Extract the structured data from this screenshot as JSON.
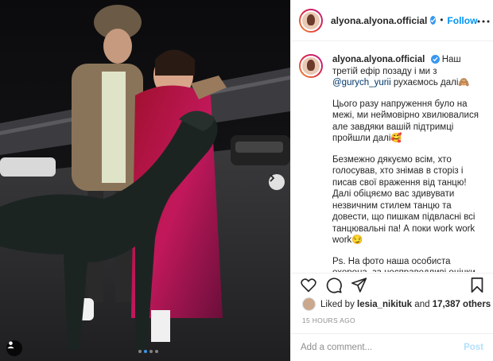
{
  "post": {
    "username": "alyona.alyona.official",
    "follow_label": "Follow",
    "separator": "•"
  },
  "caption": {
    "username": "alyona.alyona.official",
    "line1": "Наш третій ефір позаду і ми з",
    "mention": "@gurych_yurii",
    "line1_end": "рухаємось далі🙈",
    "p2": "Цього разу напруження було на межі, ми неймовірно хвилювалися але завдяки вашій підтримці пройшли далі🥰",
    "p3": "Безмежно дякуємо всім, хто голосував, хто знімав в сторіз і писав свої враження від танцю! Далі обіцяємо вас здивувати незвичним стилем танцю та довести, що пишкам підвласні всі танцювальні па! А поки work work work😏",
    "p4": "Ps. На фото наша особиста охорона, за несправедливі оцінки може і"
  },
  "likes": {
    "prefix": "Liked by",
    "user": "lesia_nikituk",
    "conj": "and",
    "others": "17,387 others"
  },
  "timestamp": "15 HOURS AGO",
  "comment": {
    "placeholder": "Add a comment...",
    "post_label": "Post"
  },
  "icons": {
    "like": "heart-icon",
    "comment": "comment-icon",
    "share": "share-icon",
    "save": "bookmark-icon",
    "more": "more-icon",
    "next": "chevron-right-icon",
    "tag": "user-tag-icon"
  },
  "carousel": {
    "slides": 4,
    "active": 2
  },
  "colors": {
    "accent": "#0095f6",
    "verified": "#3897f0",
    "muted": "#8e8e8e"
  }
}
